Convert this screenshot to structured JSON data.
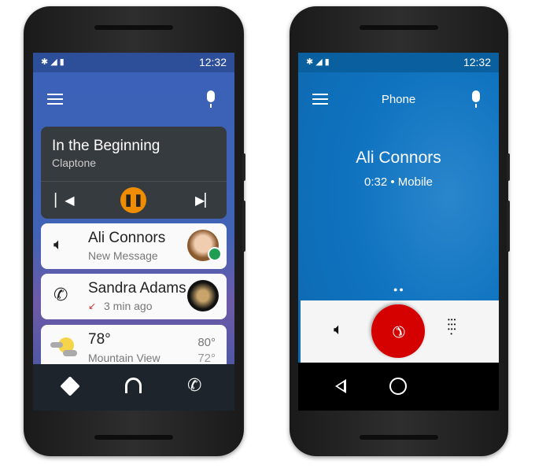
{
  "left_phone": {
    "status": {
      "time": "12:32",
      "icons": [
        "bluetooth-icon",
        "signal-icon",
        "battery-icon"
      ]
    },
    "media": {
      "title": "In the Beginning",
      "artist": "Claptone",
      "state": "playing"
    },
    "cards": [
      {
        "title": "Ali Connors",
        "subtitle": "New Message",
        "icon": "volume-icon"
      },
      {
        "title": "Sandra Adams",
        "subtitle": "3 min ago",
        "icon": "phone-icon"
      },
      {
        "title": "78°",
        "subtitle": "Mountain View",
        "high": "80°",
        "low": "72°",
        "icon": "partly-cloudy-icon"
      }
    ],
    "nav": [
      "navigation-icon",
      "headphones-icon",
      "phone-icon"
    ],
    "colors": {
      "appbar": "#3a62b8",
      "accent": "#f08c00"
    }
  },
  "right_phone": {
    "status": {
      "time": "12:32"
    },
    "title": "Phone",
    "caller": "Ali Connors",
    "call_info": "0:32 • Mobile",
    "colors": {
      "background": "#0f73c0",
      "end_call": "#d50000"
    }
  }
}
